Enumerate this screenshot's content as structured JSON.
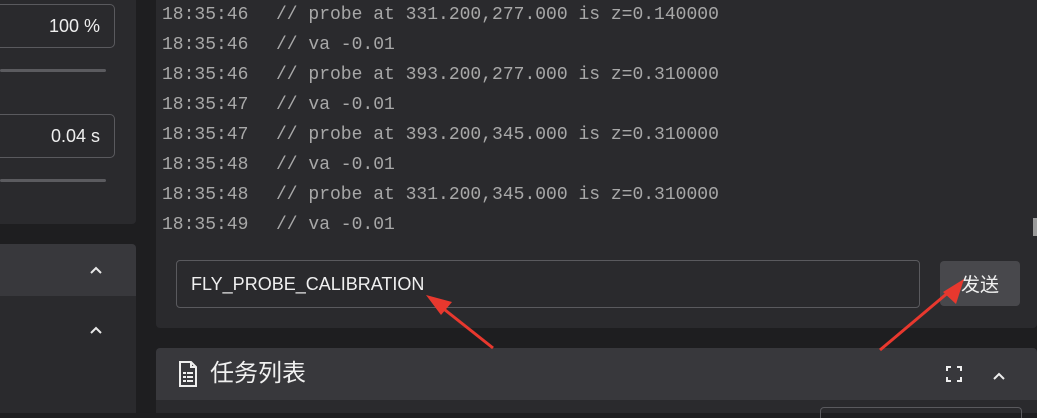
{
  "left": {
    "speed_value": "100 %",
    "time_value": "0.04 s"
  },
  "console": {
    "log": [
      {
        "time": "18:35:46",
        "message": "// probe at 331.200,277.000 is z=0.140000"
      },
      {
        "time": "18:35:46",
        "message": "// va -0.01"
      },
      {
        "time": "18:35:46",
        "message": "// probe at 393.200,277.000 is z=0.310000"
      },
      {
        "time": "18:35:47",
        "message": "// va -0.01"
      },
      {
        "time": "18:35:47",
        "message": "// probe at 393.200,345.000 is z=0.310000"
      },
      {
        "time": "18:35:48",
        "message": "// va -0.01"
      },
      {
        "time": "18:35:48",
        "message": "// probe at 331.200,345.000 is z=0.310000"
      },
      {
        "time": "18:35:49",
        "message": "// va -0.01"
      }
    ],
    "command_value": "FLY_PROBE_CALIBRATION",
    "send_label": "发送"
  },
  "task_list": {
    "title": "任务列表"
  },
  "colors": {
    "background": "#1e1e20",
    "panel": "#2a2a2d",
    "panel_header": "#38383c",
    "annotation_arrow": "#e8382e"
  },
  "icons": {
    "speed_collapse": "chevron-up-icon",
    "panel_collapse": "chevron-up-icon",
    "task_list": "document-list-icon",
    "fullscreen": "fullscreen-icon"
  }
}
